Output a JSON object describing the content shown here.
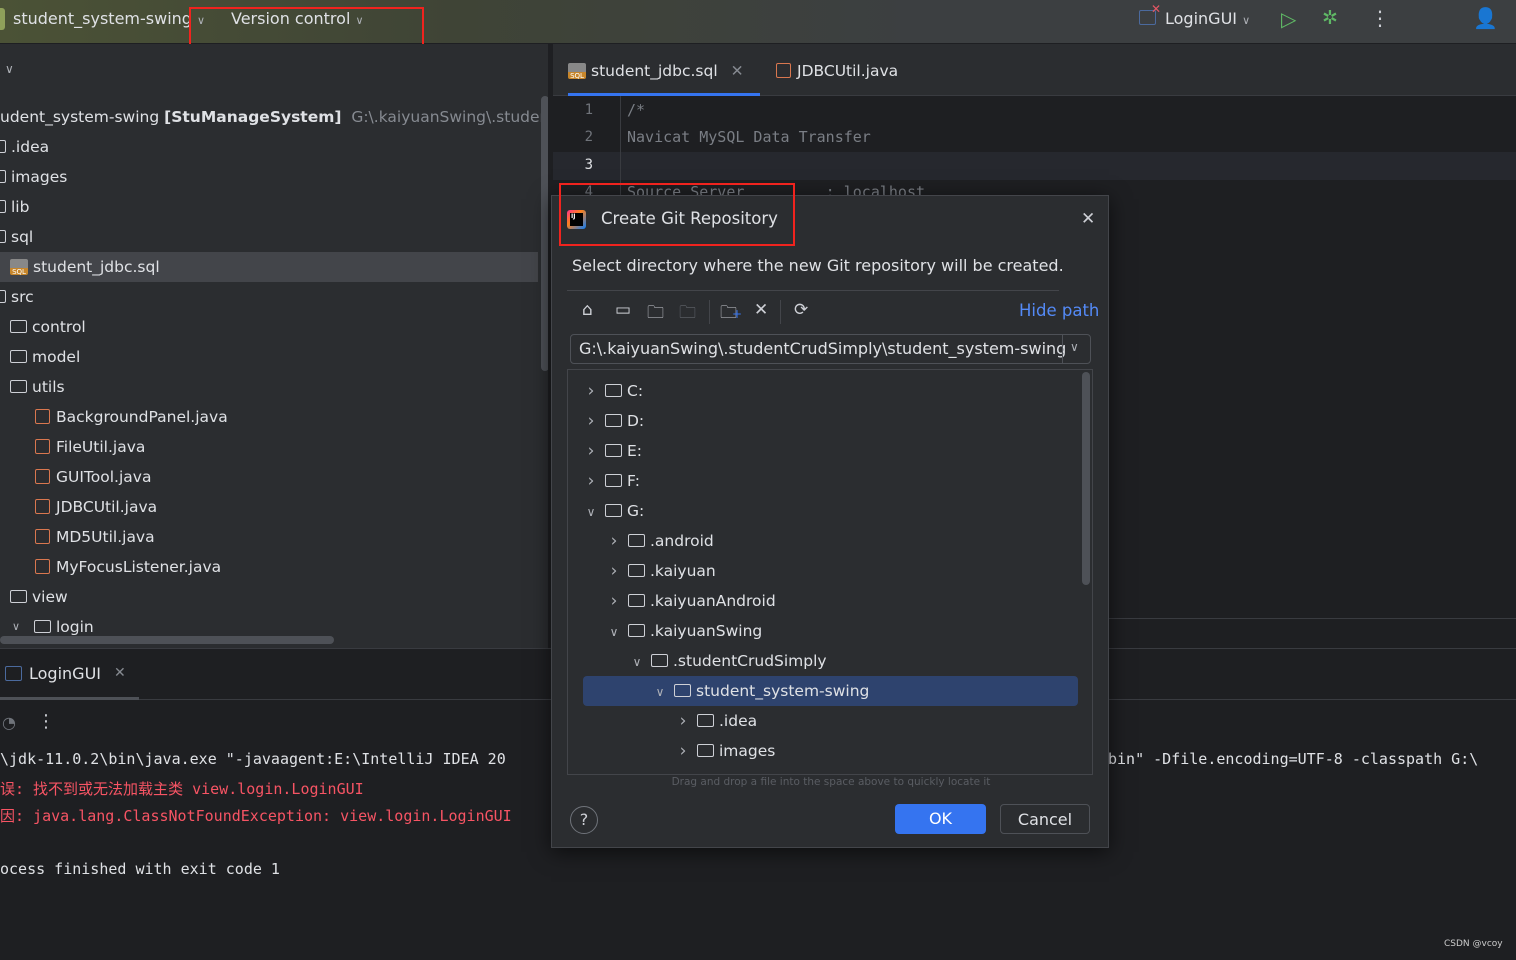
{
  "topbar": {
    "project_name": "student_system-swing",
    "vcs_menu": "Version control",
    "run_config": "LoginGUI"
  },
  "project_tree": {
    "root_label": "udent_system-swing",
    "root_module": "[StuManageSystem]",
    "root_path": "G:\\.kaiyuanSwing\\.studentC",
    "items": [
      {
        "label": ".idea",
        "type": "folder",
        "indent": 0
      },
      {
        "label": "images",
        "type": "folder",
        "indent": 0
      },
      {
        "label": "lib",
        "type": "folder",
        "indent": 0
      },
      {
        "label": "sql",
        "type": "folder",
        "indent": 0
      },
      {
        "label": "student_jdbc.sql",
        "type": "sql",
        "indent": 1,
        "selected": true
      },
      {
        "label": "src",
        "type": "folder",
        "indent": 0
      },
      {
        "label": "control",
        "type": "folder",
        "indent": 1
      },
      {
        "label": "model",
        "type": "folder",
        "indent": 1
      },
      {
        "label": "utils",
        "type": "folder",
        "indent": 1
      },
      {
        "label": "BackgroundPanel.java",
        "type": "java",
        "indent": 2
      },
      {
        "label": "FileUtil.java",
        "type": "java",
        "indent": 2
      },
      {
        "label": "GUITool.java",
        "type": "java",
        "indent": 2
      },
      {
        "label": "JDBCUtil.java",
        "type": "java",
        "indent": 2
      },
      {
        "label": "MD5Util.java",
        "type": "java",
        "indent": 2
      },
      {
        "label": "MyFocusListener.java",
        "type": "java",
        "indent": 2
      },
      {
        "label": "view",
        "type": "folder",
        "indent": 1
      },
      {
        "label": "login",
        "type": "folder",
        "indent": 2,
        "expanded": true
      }
    ]
  },
  "editor": {
    "tabs": [
      {
        "label": "student_jdbc.sql",
        "active": true
      },
      {
        "label": "JDBCUtil.java",
        "active": false
      }
    ],
    "lines": [
      {
        "n": "1",
        "text": "/*"
      },
      {
        "n": "2",
        "text": "Navicat MySQL Data Transfer"
      },
      {
        "n": "3",
        "text": ""
      },
      {
        "n": "4",
        "text": "Source Server         : localhost"
      }
    ]
  },
  "run_panel": {
    "tab_label": "LoginGUI",
    "console": [
      {
        "text": "\\jdk-11.0.2\\bin\\java.exe \"-javaagent:E:\\IntelliJ IDEA 20",
        "error": false
      },
      {
        "text": "误: 找不到或无法加载主类 view.login.LoginGUI",
        "error": true
      },
      {
        "text": "因: java.lang.ClassNotFoundException: view.login.LoginGUI",
        "error": true
      },
      {
        "text": "",
        "error": false
      },
      {
        "text": "ocess finished with exit code 1",
        "error": false
      }
    ],
    "console_right": "bin\" -Dfile.encoding=UTF-8 -classpath G:\\"
  },
  "dialog": {
    "title": "Create Git Repository",
    "description": "Select directory where the new Git repository will be created.",
    "hide_path": "Hide path",
    "path_value": "G:\\.kaiyuanSwing\\.studentCrudSimply\\student_system-swing",
    "tree": [
      {
        "label": "C:",
        "indent": 0,
        "expanded": false
      },
      {
        "label": "D:",
        "indent": 0,
        "expanded": false
      },
      {
        "label": "E:",
        "indent": 0,
        "expanded": false
      },
      {
        "label": "F:",
        "indent": 0,
        "expanded": false
      },
      {
        "label": "G:",
        "indent": 0,
        "expanded": true
      },
      {
        "label": ".android",
        "indent": 1,
        "expanded": false
      },
      {
        "label": ".kaiyuan",
        "indent": 1,
        "expanded": false
      },
      {
        "label": ".kaiyuanAndroid",
        "indent": 1,
        "expanded": false
      },
      {
        "label": ".kaiyuanSwing",
        "indent": 1,
        "expanded": true
      },
      {
        "label": ".studentCrudSimply",
        "indent": 2,
        "expanded": true
      },
      {
        "label": "student_system-swing",
        "indent": 3,
        "expanded": true,
        "selected": true
      },
      {
        "label": ".idea",
        "indent": 4,
        "expanded": false
      },
      {
        "label": "images",
        "indent": 4,
        "expanded": false
      }
    ],
    "drop_hint": "Drag and drop a file into the space above to quickly locate it",
    "ok": "OK",
    "cancel": "Cancel",
    "help": "?"
  },
  "watermark": "CSDN @vcoy",
  "colors": {
    "accent": "#3574f0",
    "error": "#f75464",
    "highlight_box": "#f0231e",
    "selection": "#2e436e"
  }
}
